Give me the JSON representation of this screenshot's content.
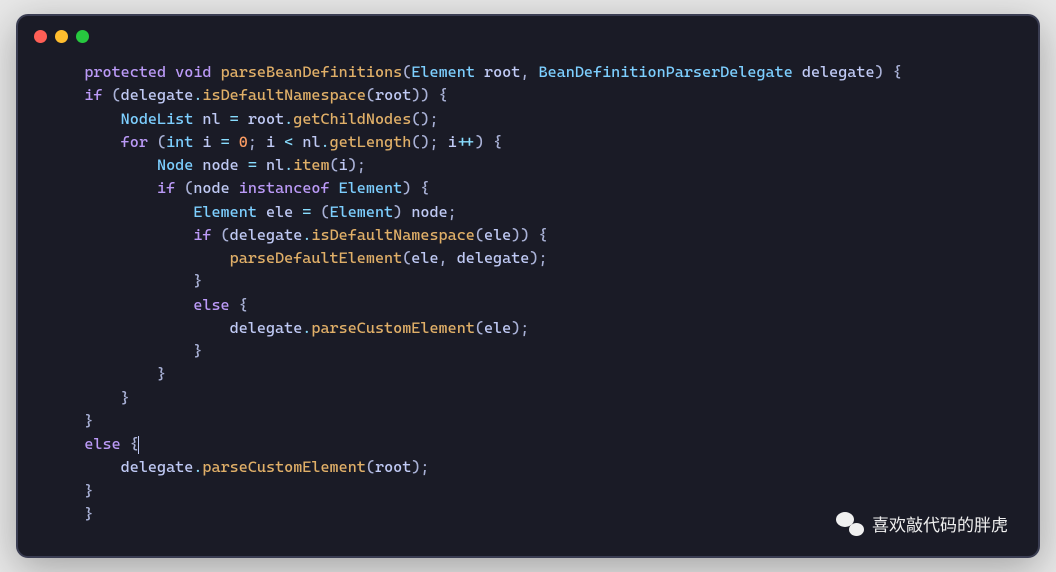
{
  "code": {
    "line1": {
      "kw1": "protected",
      "kw2": "void",
      "method": "parseBeanDefinitions",
      "p1": "(",
      "type1": "Element",
      "var1": " root",
      "comma": ",",
      "type2": " BeanDefinitionParserDelegate",
      "var2": " delegate",
      "p2": ")",
      "brace": " {"
    },
    "line2": {
      "indent": "    ",
      "kw": "if",
      "p1": " (",
      "var": "delegate",
      "dot": ".",
      "method": "isDefaultNamespace",
      "p2": "(",
      "arg": "root",
      "p3": "))",
      "brace": " {"
    },
    "line3": {
      "indent": "        ",
      "type": "NodeList",
      "var": " nl",
      "op": " = ",
      "obj": "root",
      "dot": ".",
      "method": "getChildNodes",
      "p": "();"
    },
    "line4": {
      "indent": "        ",
      "kw": "for",
      "p1": " (",
      "type": "int",
      "var": " i",
      "op1": " = ",
      "num": "0",
      "semi1": ";",
      "var2": " i",
      "op2": " < ",
      "obj": "nl",
      "dot": ".",
      "method": "getLength",
      "p2": "()",
      "semi2": ";",
      "var3": " i",
      "op3": "++",
      "p3": ")",
      "brace": " {"
    },
    "line5": {
      "indent": "            ",
      "type": "Node",
      "var": " node",
      "op": " = ",
      "obj": "nl",
      "dot": ".",
      "method": "item",
      "p1": "(",
      "arg": "i",
      "p2": ");"
    },
    "line6": {
      "indent": "            ",
      "kw": "if",
      "p1": " (",
      "var": "node",
      "kw2": " instanceof ",
      "type": "Element",
      "p2": ")",
      "brace": " {"
    },
    "line7": {
      "indent": "                ",
      "type": "Element",
      "var": " ele",
      "op": " = ",
      "p1": "(",
      "type2": "Element",
      "p2": ")",
      "var2": " node",
      "semi": ";"
    },
    "line8": {
      "indent": "                ",
      "kw": "if",
      "p1": " (",
      "var": "delegate",
      "dot": ".",
      "method": "isDefaultNamespace",
      "p2": "(",
      "arg": "ele",
      "p3": "))",
      "brace": " {"
    },
    "line9": {
      "indent": "                    ",
      "method": "parseDefaultElement",
      "p1": "(",
      "arg1": "ele",
      "comma": ",",
      "arg2": " delegate",
      "p2": ");"
    },
    "line10": {
      "indent": "                ",
      "brace": "}"
    },
    "line11": {
      "indent": "                ",
      "kw": "else",
      "brace": " {"
    },
    "line12": {
      "indent": "                    ",
      "var": "delegate",
      "dot": ".",
      "method": "parseCustomElement",
      "p1": "(",
      "arg": "ele",
      "p2": ");"
    },
    "line13": {
      "indent": "                ",
      "brace": "}"
    },
    "line14": {
      "indent": "            ",
      "brace": "}"
    },
    "line15": {
      "indent": "        ",
      "brace": "}"
    },
    "line16": {
      "indent": "    ",
      "brace": "}"
    },
    "line17": {
      "indent": "    ",
      "kw": "else",
      "brace": " {"
    },
    "line18": {
      "indent": "        ",
      "var": "delegate",
      "dot": ".",
      "method": "parseCustomElement",
      "p1": "(",
      "arg": "root",
      "p2": ");"
    },
    "line19": {
      "indent": "    ",
      "brace": "}"
    },
    "line20": {
      "brace": "}"
    }
  },
  "watermark": {
    "text": "喜欢敲代码的胖虎"
  }
}
